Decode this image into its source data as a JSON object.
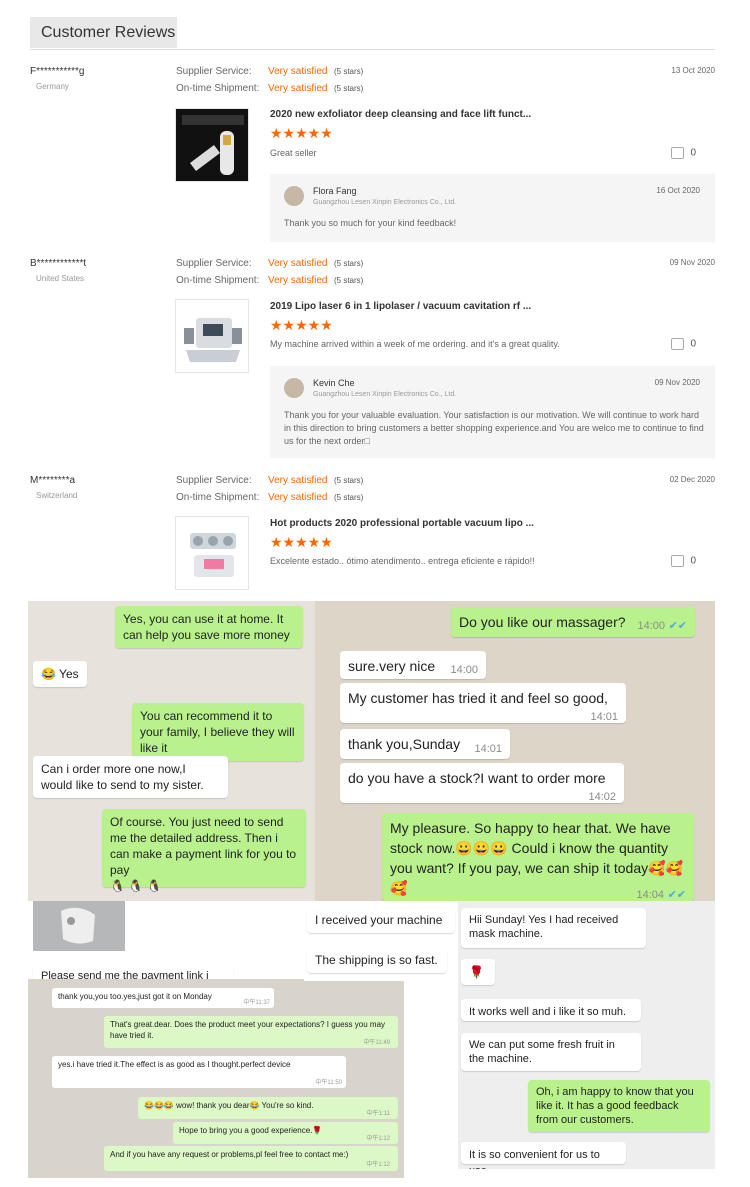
{
  "header": {
    "title": "Customer Reviews"
  },
  "reviews": [
    {
      "buyer": "F***********g",
      "country": "Germany",
      "supplier_label": "Supplier Service:",
      "supplier_value": "Very satisfied",
      "supplier_stars": "(5 stars)",
      "shipment_label": "On-time Shipment:",
      "shipment_value": "Very satisfied",
      "shipment_stars": "(5 stars)",
      "date": "13 Oct 2020",
      "product": "2020 new exfoliator deep cleansing and face lift funct...",
      "stars": "★★★★★",
      "text": "Great seller",
      "likes": "0",
      "reply": {
        "name": "Flora Fang",
        "company": "Guangzhou Lesen Xinpin Electronics Co., Ltd.",
        "date": "16 Oct 2020",
        "text": "Thank you so much for your kind feedback!"
      }
    },
    {
      "buyer": "B************t",
      "country": "United States",
      "supplier_label": "Supplier Service:",
      "supplier_value": "Very satisfied",
      "supplier_stars": "(5 stars)",
      "shipment_label": "On-time Shipment:",
      "shipment_value": "Very satisfied",
      "shipment_stars": "(5 stars)",
      "date": "09 Nov 2020",
      "product": "2019 Lipo laser 6 in 1 lipolaser / vacuum cavitation rf ...",
      "stars": "★★★★★",
      "text": "My machine arrived within a week of me ordering. and it's a great quality.",
      "likes": "0",
      "reply": {
        "name": "Kevin Che",
        "company": "Guangzhou Lesen Xinpin Electronics Co., Ltd.",
        "date": "09 Nov 2020",
        "text": "Thank you for your valuable evaluation. Your satisfaction is our motivation. We will continue to work hard in this direction to bring customers a better shopping experience.and You are welco me to continue to find us for the next order□"
      }
    },
    {
      "buyer": "M********a",
      "country": "Switzerland",
      "supplier_label": "Supplier Service:",
      "supplier_value": "Very satisfied",
      "supplier_stars": "(5 stars)",
      "shipment_label": "On-time Shipment:",
      "shipment_value": "Very satisfied",
      "shipment_stars": "(5 stars)",
      "date": "02 Dec 2020",
      "product": "Hot products 2020 professional portable vacuum lipo ...",
      "stars": "★★★★★",
      "text": "Excelente estado.. ótimo atendimento.. entrega eficiente e rápido!!",
      "likes": "0"
    }
  ],
  "chat_left": {
    "m1": "Yes, you can use it at home. It can help you save more money",
    "m2": "😂 Yes",
    "m3": "You can recommend it to your family, I believe they will like it",
    "m4": "Can i order more one now,I would like to send to my sister.",
    "m5": "Of course. You just need to send me the detailed address. Then i can make a payment link for you to pay",
    "m5_emoji": "🐧 🐧 🐧",
    "m6": "Please send me the payment link i"
  },
  "chat_right": {
    "m1": "Do you like our massager?",
    "t1": "14:00",
    "m2": "sure.very nice",
    "t2": "14:00",
    "m3": "My customer has tried it and feel so good,",
    "t3": "14:01",
    "m4": "thank you,Sunday",
    "t4": "14:01",
    "m5": "do you have a stock?I want to order more",
    "t5": "14:02",
    "m6": "My pleasure. So happy to hear that. We have stock now.😀😀😀 Could i know the quantity you want? If you pay, we can ship it today🥰🥰🥰",
    "t6": "14:04"
  },
  "chat_bottom": {
    "m1": "thank you,you too.yes,just got it on Monday",
    "t1": "中午11:37",
    "m2": "That's great.dear.  Does the product meet your expectations? I guess you may have tried it.",
    "t2": "中午11:49",
    "m3": "yes.i have tried it.The effect is as good as I thought.perfect device",
    "t3": "中午11:50",
    "m4": "😂😂😂  wow! thank you dear😂 You're so kind.",
    "t4": "中午1:11",
    "m5": "Hope to bring you a good experience.🌹",
    "t5": "中午1:12",
    "m6": "And if you have any request or problems,pl feel free to contact me:)",
    "t6": "中午1:12"
  },
  "chat_mid": {
    "m1": "I received your machine",
    "m2": "The shipping is so fast."
  },
  "chat_far": {
    "m1": "Hii Sunday! Yes I had received mask machine.",
    "m2": "🌹",
    "m3": "It works well and i like it so muh.",
    "m4": "We can put some fresh  fruit in the machine.",
    "m5": "Oh, i am happy to know that you like it. It has a good feedback from our customers.",
    "m6": "It is so convenient for us to use."
  }
}
